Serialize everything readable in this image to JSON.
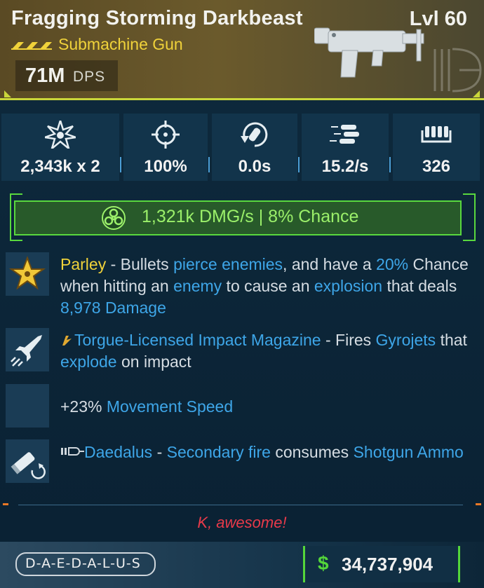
{
  "weapon": {
    "name": "Fragging Storming Darkbeast",
    "level": "Lvl 60",
    "type": "Submachine Gun",
    "dps_value": "71M",
    "dps_label": "DPS"
  },
  "stats": [
    {
      "icon": "damage-burst-icon",
      "value": "2,343k x 2"
    },
    {
      "icon": "crosshair-accuracy-icon",
      "value": "100%"
    },
    {
      "icon": "reload-icon",
      "value": "0.0s"
    },
    {
      "icon": "fire-rate-icon",
      "value": "15.2/s"
    },
    {
      "icon": "ammo-icon",
      "value": "326"
    }
  ],
  "element": {
    "icon": "corrosive-biohazard-icon",
    "text": "1,321k DMG/s | 8% Chance"
  },
  "perks": [
    {
      "icon": "parley-star-icon",
      "name": "Parley",
      "t1": " - Bullets ",
      "h1": "pierce enemies",
      "t2": ", and have a ",
      "h2": "20%",
      "t3": " Chance when hitting an ",
      "h3": "enemy",
      "t4": " to cause an ",
      "h4": "explosion",
      "t5": " that deals ",
      "h5": "8,978 Damage"
    },
    {
      "icon": "gyrojet-rocket-icon",
      "badge_icon": "torgue-badge-icon",
      "name": "Torgue-Licensed Impact Magazine",
      "t1": " - Fires ",
      "h1": "Gyrojets",
      "t2": " that ",
      "h2": "explode",
      "t3": " on impact"
    },
    {
      "icon": "",
      "t1": "+23% ",
      "h1": "Movement Speed"
    },
    {
      "icon": "shotgun-shell-swap-icon",
      "badge_icon": "daedalus-badge-icon",
      "name": "Daedalus",
      "t1": " - ",
      "h1": "Secondary fire",
      "t2": " consumes ",
      "h2": "Shotgun Ammo"
    }
  ],
  "flavor_text": "K, awesome!",
  "manufacturer": "D-A-E-D-A-L-U-S",
  "price": {
    "currency": "$",
    "value": "34,737,904"
  },
  "colors": {
    "header_bg": "#5a4a24",
    "rarity_yellow": "#f0d23a",
    "corrosive_green": "#59d83e",
    "highlight_blue": "#3ea6e8",
    "flavor_red": "#e83a4a",
    "card_bg": "#0e2a3d"
  }
}
